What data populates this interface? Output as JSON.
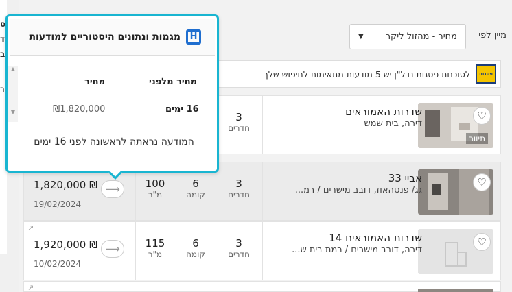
{
  "sort": {
    "label": "מיין לפי",
    "selected": "מחיר - מהזול ליקר"
  },
  "promo": {
    "text": "לסוכנות פסגות נדל\"ן יש 5 מודעות מתאימות לחיפוש שלך",
    "logo_text": "פסגות"
  },
  "left_fragment": {
    "chars": [
      "ס",
      "ד",
      "ב"
    ],
    "label": "ר"
  },
  "popup": {
    "title": "מגמות ונתונים היסטוריים למודעות",
    "col_before": "מחיר מלפני",
    "col_price": "מחיר",
    "days": "16 ימים",
    "price": "₪1,820,000",
    "footer": "המודעה נראתה לראשונה לפני 16 ימים"
  },
  "listings": [
    {
      "title": "שדרות האמוראים",
      "subtitle": "דירה, בית שמש",
      "tag": "תיוור",
      "rooms": "3",
      "rooms_label": "חדרים",
      "highlight": false
    },
    {
      "title": "אביי 33",
      "subtitle": "גג/ פנטהאוז, דובב מישרים / רמ...",
      "rooms": "3",
      "rooms_label": "חדרים",
      "floor": "6",
      "floor_label": "קומה",
      "size": "100",
      "size_label": "מ\"ר",
      "price": "1,820,000 ₪",
      "date": "19/02/2024",
      "highlight": true
    },
    {
      "title": "שדרות האמוראים 14",
      "subtitle": "דירה, דובב מישרים / רמת בית ש...",
      "rooms": "3",
      "rooms_label": "חדרים",
      "floor": "6",
      "floor_label": "קומה",
      "size": "115",
      "size_label": "מ\"ר",
      "price": "1,920,000 ₪",
      "date": "10/02/2024",
      "highlight": false
    }
  ],
  "icons": {
    "heart": "heart-icon",
    "arrow": "arrow-right-icon",
    "external": "external-link-icon"
  }
}
